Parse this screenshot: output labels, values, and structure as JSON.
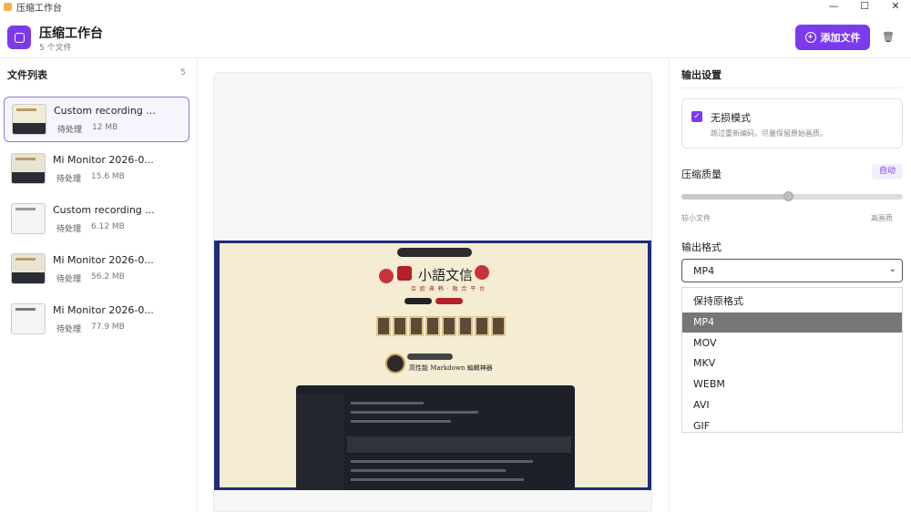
{
  "window": {
    "title": "压缩工作台",
    "controls": [
      "—",
      "☐",
      "✕"
    ]
  },
  "header": {
    "title": "压缩工作台",
    "subtitle": "5 个文件",
    "add_button": "添加文件",
    "accent": "#7c3aed"
  },
  "file_list": {
    "title": "文件列表",
    "count": "5",
    "items": [
      {
        "name": "Custom recording ...",
        "status": "待处理",
        "size": "12 MB"
      },
      {
        "name": "Mi Monitor 2026-0...",
        "status": "待处理",
        "size": "15.6 MB"
      },
      {
        "name": "Custom recording ...",
        "status": "待处理",
        "size": "6.12 MB"
      },
      {
        "name": "Mi Monitor 2026-0...",
        "status": "待处理",
        "size": "56.2 MB"
      },
      {
        "name": "Mi Monitor 2026-0...",
        "status": "待处理",
        "size": "77.9 MB"
      }
    ]
  },
  "preview": {
    "title": "小語文信",
    "subtitle": "亞 欧 典 韩 · 融 合 平 台",
    "tagline": "高性能 Markdown 編輯神器"
  },
  "settings": {
    "title": "输出设置",
    "lossless": {
      "label": "无损模式",
      "description": "跳过重新编码，尽量保留原始画质。",
      "checked": true
    },
    "quality": {
      "label": "压缩质量",
      "badge": "自动",
      "min_label": "较小文件",
      "max_label": "高画质",
      "level": 0.48
    },
    "format": {
      "label": "输出格式",
      "selected": "MP4",
      "options": [
        "保持原格式",
        "MP4",
        "MOV",
        "MKV",
        "WEBM",
        "AVI",
        "GIF"
      ]
    }
  }
}
